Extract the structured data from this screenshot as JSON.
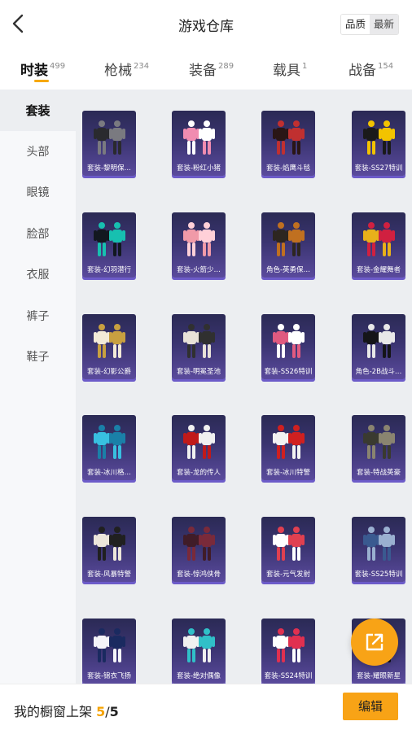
{
  "header": {
    "title": "游戏仓库",
    "sort_quality": "品质",
    "sort_newest": "最新"
  },
  "tabs": [
    {
      "label": "时装",
      "count": "499"
    },
    {
      "label": "枪械",
      "count": "234"
    },
    {
      "label": "装备",
      "count": "289"
    },
    {
      "label": "载具",
      "count": "1"
    },
    {
      "label": "战备",
      "count": "154"
    }
  ],
  "sidebar": [
    "套装",
    "头部",
    "眼镜",
    "脸部",
    "衣服",
    "裤子",
    "鞋子"
  ],
  "items": [
    {
      "label": "套装-黎明保…",
      "c1": "#2a2a2e",
      "c2": "#7a7a80"
    },
    {
      "label": "套装-粉红小猪",
      "c1": "#f08cb0",
      "c2": "#ffffff"
    },
    {
      "label": "套装-焰鹰斗毯",
      "c1": "#2a1616",
      "c2": "#c03030"
    },
    {
      "label": "套装-SS27特训",
      "c1": "#1a1a1a",
      "c2": "#f2c300"
    },
    {
      "label": "套装-幻羽潜行",
      "c1": "#121820",
      "c2": "#17c0b0"
    },
    {
      "label": "套装-火箭少…",
      "c1": "#f09aa8",
      "c2": "#ffd0d8"
    },
    {
      "label": "角色-英勇保…",
      "c1": "#2d2620",
      "c2": "#c07020"
    },
    {
      "label": "套装-金耀舞者",
      "c1": "#e8b01a",
      "c2": "#d02040"
    },
    {
      "label": "套装-幻影公爵",
      "c1": "#f2ead8",
      "c2": "#c8a040"
    },
    {
      "label": "套装-明冕圣池",
      "c1": "#e8e2d8",
      "c2": "#303030"
    },
    {
      "label": "套装-SS26特训",
      "c1": "#e05a80",
      "c2": "#ffffff"
    },
    {
      "label": "角色-2B战斗…",
      "c1": "#151518",
      "c2": "#e8e8e8"
    },
    {
      "label": "套装-冰川格…",
      "c1": "#38c0e0",
      "c2": "#1a80a8"
    },
    {
      "label": "套装-龙的传人",
      "c1": "#c01a1a",
      "c2": "#f0f0f0"
    },
    {
      "label": "套装-冰川特警",
      "c1": "#f2f2f2",
      "c2": "#d02020"
    },
    {
      "label": "套装-特战英豪",
      "c1": "#3a3a30",
      "c2": "#8a8470"
    },
    {
      "label": "套装-风暴特警",
      "c1": "#ece6da",
      "c2": "#202020"
    },
    {
      "label": "套装-惊鸿侠骨",
      "c1": "#401c28",
      "c2": "#7a2a3a"
    },
    {
      "label": "套装-元气发射",
      "c1": "#ffffff",
      "c2": "#e04050"
    },
    {
      "label": "套装-SS25特训",
      "c1": "#3a5a90",
      "c2": "#9ab0d0"
    },
    {
      "label": "套装-锦衣飞扬",
      "c1": "#f4f4f8",
      "c2": "#1a2a60"
    },
    {
      "label": "套装-绝对偶像",
      "c1": "#f0f0f0",
      "c2": "#30c0c8"
    },
    {
      "label": "套装-SS24特训",
      "c1": "#ffffff",
      "c2": "#e03050"
    },
    {
      "label": "套装-耀眼新星",
      "c1": "#101010",
      "c2": "#c0a040"
    }
  ],
  "bottom": {
    "shelf_label": "我的橱窗上架",
    "shelf_current": "5",
    "shelf_separator": "/",
    "shelf_total": "5",
    "edit_label": "编辑"
  },
  "colors": {
    "accent": "#f8a316",
    "card_top": "#2b2a55",
    "card_bottom": "#5a4a9c"
  },
  "icons": {
    "back": "chevron-left-icon",
    "share": "share-icon"
  }
}
